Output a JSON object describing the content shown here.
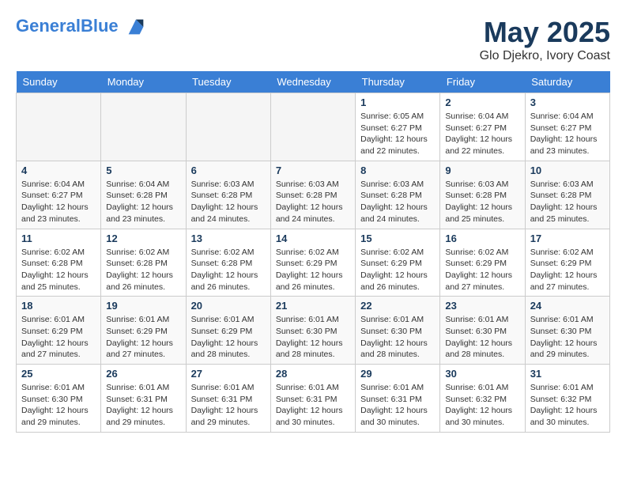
{
  "header": {
    "logo_line1": "General",
    "logo_line2": "Blue",
    "month_title": "May 2025",
    "location": "Glo Djekro, Ivory Coast"
  },
  "weekdays": [
    "Sunday",
    "Monday",
    "Tuesday",
    "Wednesday",
    "Thursday",
    "Friday",
    "Saturday"
  ],
  "weeks": [
    [
      {
        "day": "",
        "info": ""
      },
      {
        "day": "",
        "info": ""
      },
      {
        "day": "",
        "info": ""
      },
      {
        "day": "",
        "info": ""
      },
      {
        "day": "1",
        "info": "Sunrise: 6:05 AM\nSunset: 6:27 PM\nDaylight: 12 hours\nand 22 minutes."
      },
      {
        "day": "2",
        "info": "Sunrise: 6:04 AM\nSunset: 6:27 PM\nDaylight: 12 hours\nand 22 minutes."
      },
      {
        "day": "3",
        "info": "Sunrise: 6:04 AM\nSunset: 6:27 PM\nDaylight: 12 hours\nand 23 minutes."
      }
    ],
    [
      {
        "day": "4",
        "info": "Sunrise: 6:04 AM\nSunset: 6:27 PM\nDaylight: 12 hours\nand 23 minutes."
      },
      {
        "day": "5",
        "info": "Sunrise: 6:04 AM\nSunset: 6:28 PM\nDaylight: 12 hours\nand 23 minutes."
      },
      {
        "day": "6",
        "info": "Sunrise: 6:03 AM\nSunset: 6:28 PM\nDaylight: 12 hours\nand 24 minutes."
      },
      {
        "day": "7",
        "info": "Sunrise: 6:03 AM\nSunset: 6:28 PM\nDaylight: 12 hours\nand 24 minutes."
      },
      {
        "day": "8",
        "info": "Sunrise: 6:03 AM\nSunset: 6:28 PM\nDaylight: 12 hours\nand 24 minutes."
      },
      {
        "day": "9",
        "info": "Sunrise: 6:03 AM\nSunset: 6:28 PM\nDaylight: 12 hours\nand 25 minutes."
      },
      {
        "day": "10",
        "info": "Sunrise: 6:03 AM\nSunset: 6:28 PM\nDaylight: 12 hours\nand 25 minutes."
      }
    ],
    [
      {
        "day": "11",
        "info": "Sunrise: 6:02 AM\nSunset: 6:28 PM\nDaylight: 12 hours\nand 25 minutes."
      },
      {
        "day": "12",
        "info": "Sunrise: 6:02 AM\nSunset: 6:28 PM\nDaylight: 12 hours\nand 26 minutes."
      },
      {
        "day": "13",
        "info": "Sunrise: 6:02 AM\nSunset: 6:28 PM\nDaylight: 12 hours\nand 26 minutes."
      },
      {
        "day": "14",
        "info": "Sunrise: 6:02 AM\nSunset: 6:29 PM\nDaylight: 12 hours\nand 26 minutes."
      },
      {
        "day": "15",
        "info": "Sunrise: 6:02 AM\nSunset: 6:29 PM\nDaylight: 12 hours\nand 26 minutes."
      },
      {
        "day": "16",
        "info": "Sunrise: 6:02 AM\nSunset: 6:29 PM\nDaylight: 12 hours\nand 27 minutes."
      },
      {
        "day": "17",
        "info": "Sunrise: 6:02 AM\nSunset: 6:29 PM\nDaylight: 12 hours\nand 27 minutes."
      }
    ],
    [
      {
        "day": "18",
        "info": "Sunrise: 6:01 AM\nSunset: 6:29 PM\nDaylight: 12 hours\nand 27 minutes."
      },
      {
        "day": "19",
        "info": "Sunrise: 6:01 AM\nSunset: 6:29 PM\nDaylight: 12 hours\nand 27 minutes."
      },
      {
        "day": "20",
        "info": "Sunrise: 6:01 AM\nSunset: 6:29 PM\nDaylight: 12 hours\nand 28 minutes."
      },
      {
        "day": "21",
        "info": "Sunrise: 6:01 AM\nSunset: 6:30 PM\nDaylight: 12 hours\nand 28 minutes."
      },
      {
        "day": "22",
        "info": "Sunrise: 6:01 AM\nSunset: 6:30 PM\nDaylight: 12 hours\nand 28 minutes."
      },
      {
        "day": "23",
        "info": "Sunrise: 6:01 AM\nSunset: 6:30 PM\nDaylight: 12 hours\nand 28 minutes."
      },
      {
        "day": "24",
        "info": "Sunrise: 6:01 AM\nSunset: 6:30 PM\nDaylight: 12 hours\nand 29 minutes."
      }
    ],
    [
      {
        "day": "25",
        "info": "Sunrise: 6:01 AM\nSunset: 6:30 PM\nDaylight: 12 hours\nand 29 minutes."
      },
      {
        "day": "26",
        "info": "Sunrise: 6:01 AM\nSunset: 6:31 PM\nDaylight: 12 hours\nand 29 minutes."
      },
      {
        "day": "27",
        "info": "Sunrise: 6:01 AM\nSunset: 6:31 PM\nDaylight: 12 hours\nand 29 minutes."
      },
      {
        "day": "28",
        "info": "Sunrise: 6:01 AM\nSunset: 6:31 PM\nDaylight: 12 hours\nand 30 minutes."
      },
      {
        "day": "29",
        "info": "Sunrise: 6:01 AM\nSunset: 6:31 PM\nDaylight: 12 hours\nand 30 minutes."
      },
      {
        "day": "30",
        "info": "Sunrise: 6:01 AM\nSunset: 6:32 PM\nDaylight: 12 hours\nand 30 minutes."
      },
      {
        "day": "31",
        "info": "Sunrise: 6:01 AM\nSunset: 6:32 PM\nDaylight: 12 hours\nand 30 minutes."
      }
    ]
  ]
}
